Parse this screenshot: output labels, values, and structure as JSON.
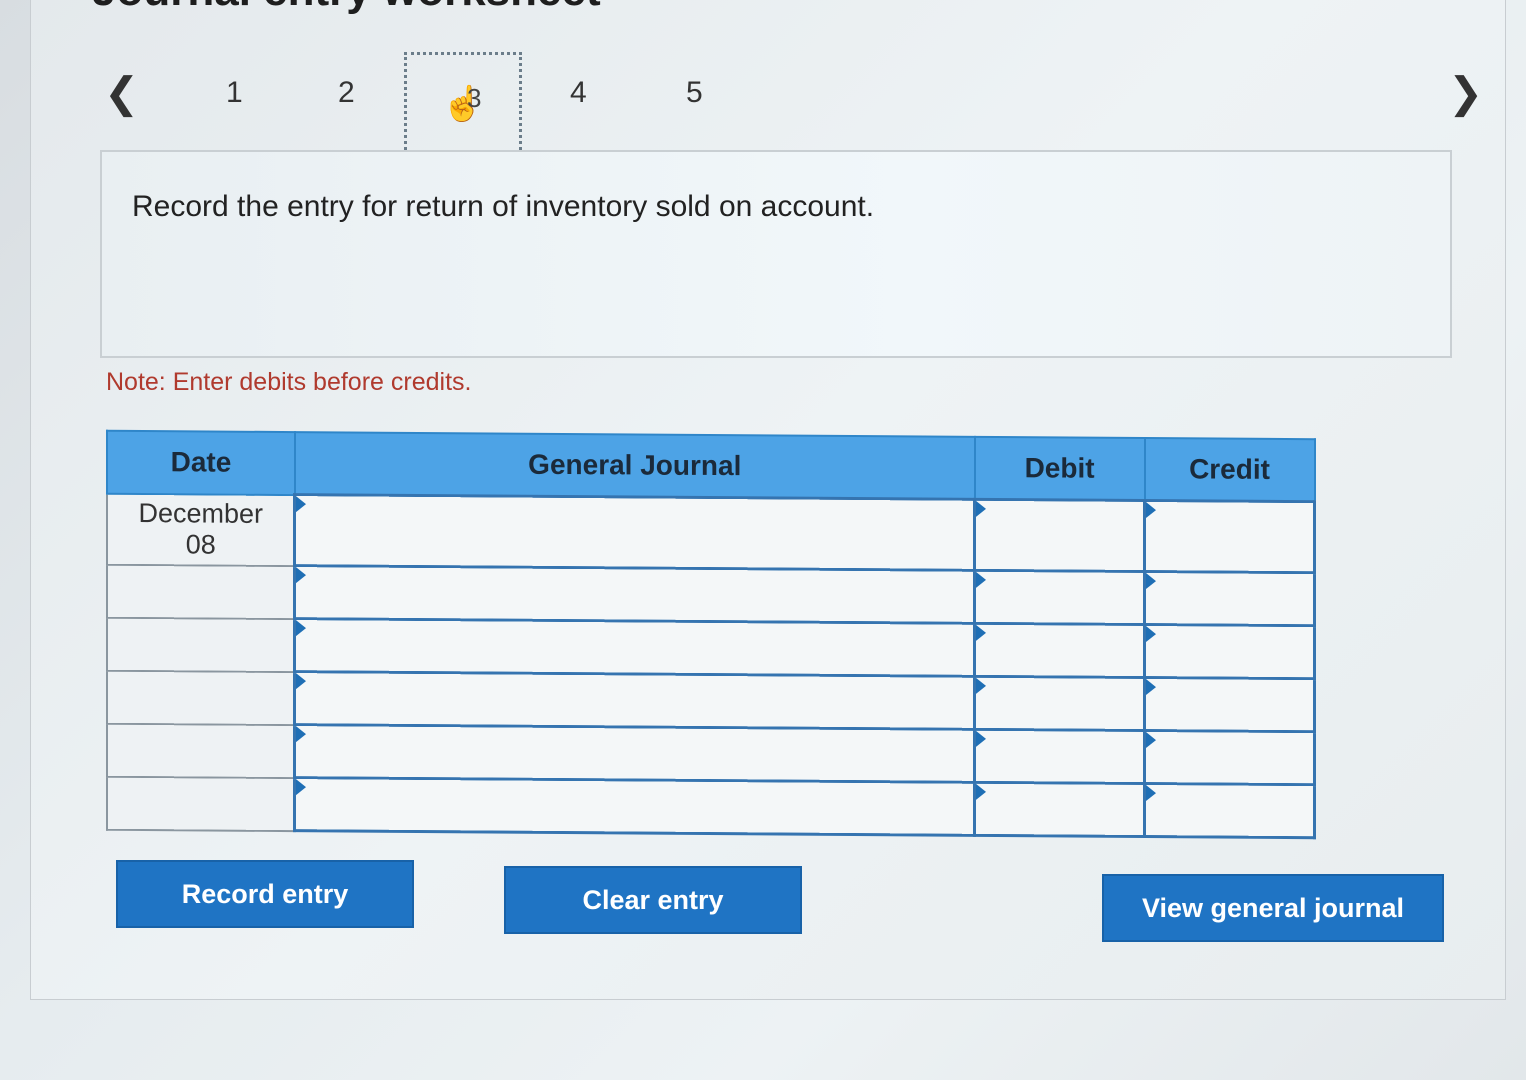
{
  "page": {
    "title": "Journal entry worksheet"
  },
  "nav": {
    "prev_icon": "chevron-left",
    "next_icon": "chevron-right",
    "steps": [
      "1",
      "2",
      "3",
      "4",
      "5"
    ],
    "current_step": "3",
    "current_step_icon": "pointer-hand"
  },
  "question": {
    "text": "Record the entry for return of inventory sold on account."
  },
  "note": "Note: Enter debits before credits.",
  "journal": {
    "headers": {
      "date": "Date",
      "general_journal": "General Journal",
      "debit": "Debit",
      "credit": "Credit"
    },
    "rows": [
      {
        "date_line1": "December",
        "date_line2": "08",
        "account": "",
        "debit": "",
        "credit": ""
      },
      {
        "date_line1": "",
        "date_line2": "",
        "account": "",
        "debit": "",
        "credit": ""
      },
      {
        "date_line1": "",
        "date_line2": "",
        "account": "",
        "debit": "",
        "credit": ""
      },
      {
        "date_line1": "",
        "date_line2": "",
        "account": "",
        "debit": "",
        "credit": ""
      },
      {
        "date_line1": "",
        "date_line2": "",
        "account": "",
        "debit": "",
        "credit": ""
      },
      {
        "date_line1": "",
        "date_line2": "",
        "account": "",
        "debit": "",
        "credit": ""
      }
    ]
  },
  "buttons": {
    "record": "Record entry",
    "clear": "Clear entry",
    "view": "View general journal"
  },
  "colors": {
    "header_blue": "#4da3e6",
    "button_blue": "#1f74c4",
    "note_red": "#b03a2e"
  }
}
